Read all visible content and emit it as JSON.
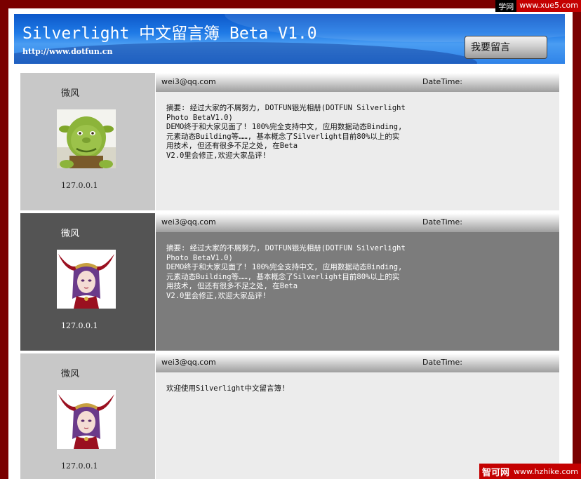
{
  "watermark_top": {
    "site": "学网",
    "url": "www.xue5.com"
  },
  "header": {
    "title": "Silverlight 中文留言簿 Beta V1.0",
    "url": "http://www.dotfun.cn",
    "button_label": "我要留言"
  },
  "messages": [
    {
      "name": "微风",
      "ip": "127.0.0.1",
      "email": "wei3@qq.com",
      "datetime_label": "DateTime:",
      "text": "摘要:  经过大家的不屑努力, DOTFUN银光相册(DOTFUN Silverlight\nPhoto  BetaV1.0)\nDEMO终于和大家见面了! 100%完全支持中文, 应用数据动态Binding,\n元素动态Building等……, 基本概念了Silverlight目前80%以上的实\n用技术, 但还有很多不足之处, 在Beta\nV2.0里会修正,欢迎大家品评!",
      "avatar": "ogre-avatar"
    },
    {
      "name": "微风",
      "ip": "127.0.0.1",
      "email": "wei3@qq.com",
      "datetime_label": "DateTime:",
      "text": "摘要:  经过大家的不屑努力, DOTFUN银光相册(DOTFUN Silverlight\nPhoto  BetaV1.0)\nDEMO终于和大家见面了! 100%完全支持中文, 应用数据动态Binding,\n元素动态Building等……, 基本概念了Silverlight目前80%以上的实\n用技术, 但还有很多不足之处, 在Beta\nV2.0里会修正,欢迎大家品评!",
      "avatar": "warrior-girl-avatar"
    },
    {
      "name": "微风",
      "ip": "127.0.0.1",
      "email": "wei3@qq.com",
      "datetime_label": "DateTime:",
      "text": "欢迎使用Silverlight中文留言簿!",
      "avatar": "warrior-girl-avatar"
    }
  ],
  "watermark_bottom": {
    "site": "智可网",
    "url": "www.hzhike.com"
  },
  "colors": {
    "page_border": "#7a0000",
    "banner_blue": "#1f7ae6",
    "light_sidebar": "#c8c8c8",
    "light_body": "#ececec",
    "dark_sidebar": "#545454",
    "dark_body": "#7c7c7c"
  }
}
